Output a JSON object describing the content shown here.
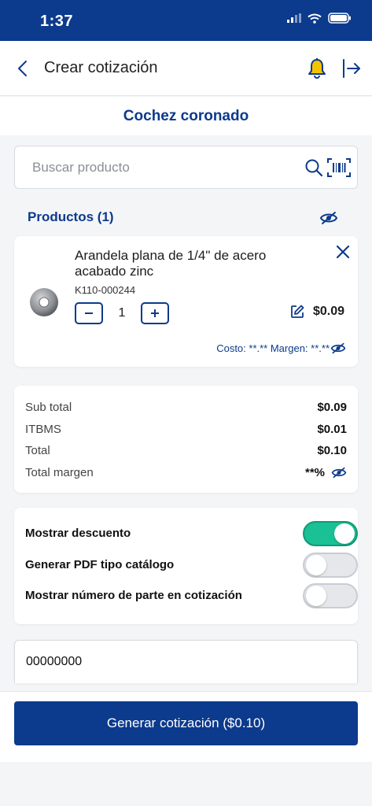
{
  "status": {
    "time": "1:37"
  },
  "header": {
    "title": "Crear cotización"
  },
  "client": {
    "name": "Cochez coronado"
  },
  "search": {
    "placeholder": "Buscar producto"
  },
  "products": {
    "heading": "Productos (1)",
    "items": [
      {
        "name": "Arandela plana de 1/4\" de acero acabado zinc",
        "sku": "K110-000244",
        "quantity": "1",
        "price": "$0.09",
        "costs_label": "Costo: **.**  Margen: **.**"
      }
    ]
  },
  "summary": {
    "subtotal_label": "Sub total",
    "subtotal_value": "$0.09",
    "itbms_label": "ITBMS",
    "itbms_value": "$0.01",
    "total_label": "Total",
    "total_value": "$0.10",
    "margin_label": "Total margen",
    "margin_value": "**%"
  },
  "toggles": [
    {
      "label": "Mostrar descuento",
      "on": true
    },
    {
      "label": "Generar PDF tipo catálogo",
      "on": false
    },
    {
      "label": "Mostrar número de parte en cotización",
      "on": false
    }
  ],
  "phone": {
    "value": "00000000"
  },
  "action": {
    "label": "Generar cotización ($0.10)"
  },
  "colors": {
    "brand": "#0c3a8c",
    "toggle_on": "#19c195",
    "bell": "#f2c400"
  },
  "icons": [
    "back-icon",
    "bell-icon",
    "logout-icon",
    "search-icon",
    "barcode-icon",
    "eye-off-icon",
    "close-icon",
    "edit-icon",
    "minus-icon",
    "plus-icon"
  ]
}
